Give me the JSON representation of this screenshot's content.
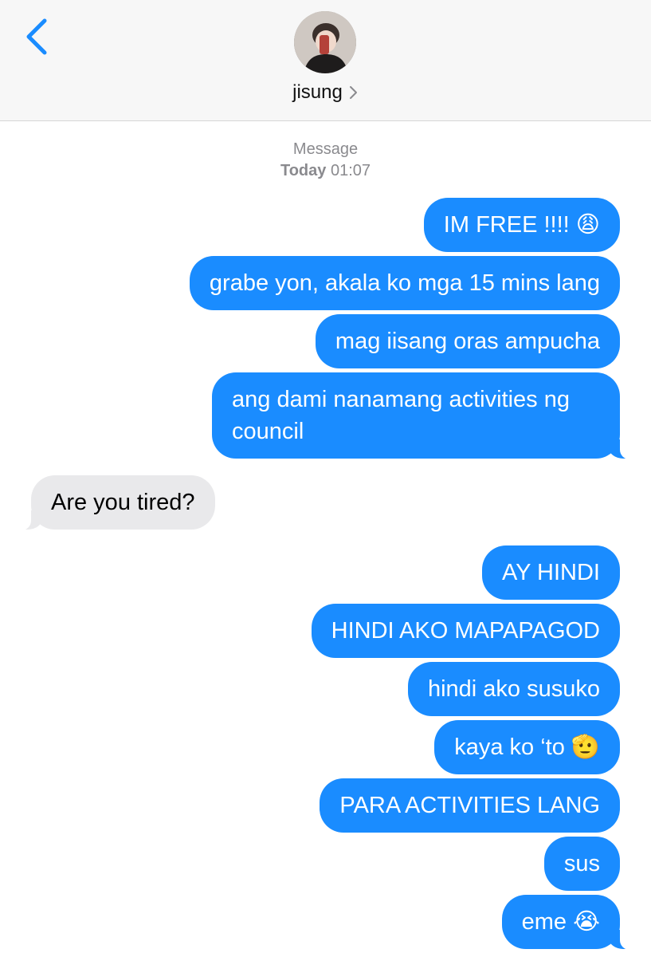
{
  "header": {
    "contact_name": "jisung",
    "back_icon": "chevron-left-icon",
    "details_icon": "chevron-right-icon",
    "accent_color": "#1a8cff"
  },
  "meta": {
    "service": "Message",
    "day": "Today",
    "time": "01:07"
  },
  "messages": [
    {
      "from": "me",
      "text": "IM FREE !!!! 😩"
    },
    {
      "from": "me",
      "text": "grabe yon, akala ko mga 15 mins lang"
    },
    {
      "from": "me",
      "text": "mag iisang oras ampucha"
    },
    {
      "from": "me",
      "text": "ang dami nanamang activities ng council"
    },
    {
      "from": "them",
      "text": "Are you tired?"
    },
    {
      "from": "me",
      "text": "AY HINDI"
    },
    {
      "from": "me",
      "text": "HINDI AKO MAPAPAGOD"
    },
    {
      "from": "me",
      "text": "hindi ako susuko"
    },
    {
      "from": "me",
      "text": "kaya ko ‘to 🫡"
    },
    {
      "from": "me",
      "text": "PARA ACTIVITIES LANG"
    },
    {
      "from": "me",
      "text": "sus"
    },
    {
      "from": "me",
      "text": "eme 😭"
    }
  ],
  "colors": {
    "outgoing_bubble": "#1a8cff",
    "incoming_bubble": "#e9e9eb",
    "meta_text": "#8a8a8e"
  }
}
